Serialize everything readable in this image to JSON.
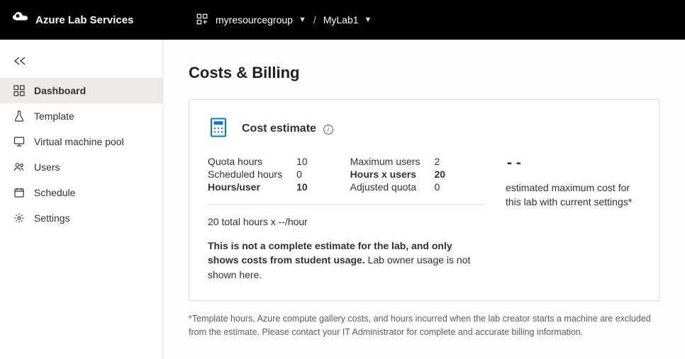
{
  "header": {
    "brand": "Azure Lab Services",
    "resource_group": "myresourcegroup",
    "lab_name": "MyLab1",
    "sep": "/"
  },
  "sidebar": {
    "items": [
      {
        "label": "Dashboard"
      },
      {
        "label": "Template"
      },
      {
        "label": "Virtual machine pool"
      },
      {
        "label": "Users"
      },
      {
        "label": "Schedule"
      },
      {
        "label": "Settings"
      }
    ]
  },
  "page": {
    "title": "Costs & Billing"
  },
  "cost_card": {
    "title": "Cost estimate",
    "left": {
      "quota_hours_k": "Quota hours",
      "quota_hours_v": "10",
      "scheduled_hours_k": "Scheduled hours",
      "scheduled_hours_v": "0",
      "hours_per_user_k": "Hours/user",
      "hours_per_user_v": "10"
    },
    "right": {
      "max_users_k": "Maximum users",
      "max_users_v": "2",
      "hours_x_users_k": "Hours x users",
      "hours_x_users_v": "20",
      "adjusted_quota_k": "Adjusted quota",
      "adjusted_quota_v": "0"
    },
    "summary": "20 total hours x --/hour",
    "disclaimer_bold": "This is not a complete estimate for the lab, and only shows costs from student usage.",
    "disclaimer_rest": " Lab owner usage is not shown here.",
    "estimate_value": "--",
    "estimate_label": "estimated maximum cost for this lab with current settings*"
  },
  "footnote": "*Template hours, Azure compute gallery costs, and hours incurred when the lab creator starts a machine are excluded from the estimate. Please contact your IT Administrator for complete and accurate billing information."
}
